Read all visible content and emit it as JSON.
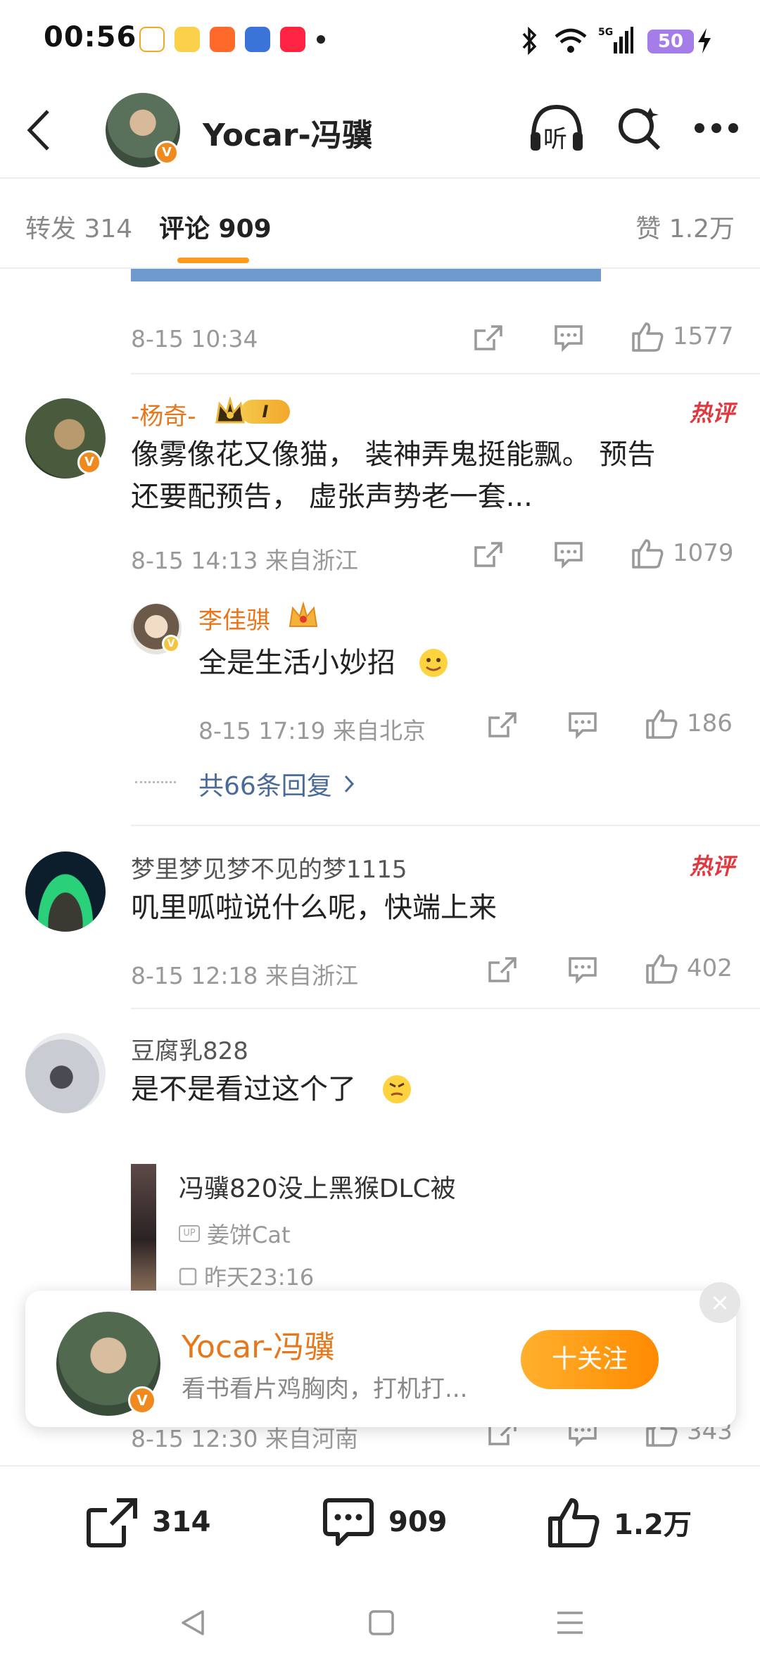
{
  "status": {
    "time": "00:56",
    "battery": "50"
  },
  "header": {
    "title": "Yocar-冯骥",
    "listen_label": "听"
  },
  "tabs": {
    "repost": "转发 314",
    "comments": "评论 909",
    "likes": "赞 1.2万"
  },
  "feed": {
    "top_meta": {
      "time": "8-15 10:34",
      "likes": "1577"
    },
    "comments": [
      {
        "user": "-杨奇-",
        "badge": "I",
        "hot": "热评",
        "text_line1": "像雾像花又像猫，  装神弄鬼挺能飘。 预告",
        "text_line2": "还要配预告，  虚张声势老一套...",
        "meta": "8-15 14:13  来自浙江",
        "likes": "1079",
        "reply": {
          "user": "李佳骐",
          "text": "全是生活小妙招",
          "meta": "8-15 17:19  来自北京",
          "likes": "186"
        },
        "reply_link": "共66条回复"
      },
      {
        "user": "梦里梦见梦不见的梦1115",
        "hot": "热评",
        "text": "叽里呱啦说什么呢，快端上来",
        "meta": "8-15 12:18  来自浙江",
        "likes": "402"
      },
      {
        "user": "豆腐乳828",
        "text": "是不是看过这个了",
        "card": {
          "title": "冯骥820没上黑猴DLC被",
          "up": "姜饼Cat",
          "time": "昨天23:16"
        },
        "meta": "8-15 12:30  来自河南",
        "likes": "343"
      }
    ]
  },
  "popup": {
    "name": "Yocar-冯骥",
    "desc": "看书看片鸡胸肉，打机打...",
    "follow": "十关注",
    "close": "×"
  },
  "bottom": {
    "repost": "314",
    "comments": "909",
    "likes": "1.2万"
  }
}
